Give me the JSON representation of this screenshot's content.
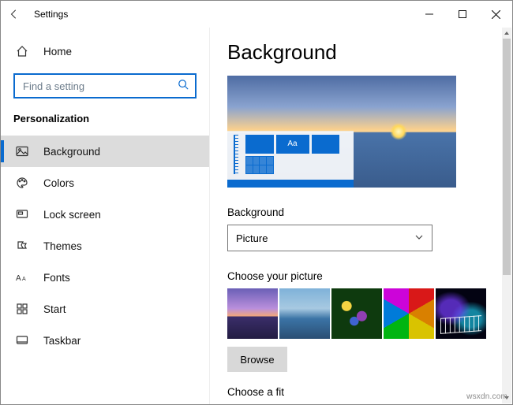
{
  "titlebar": {
    "title": "Settings"
  },
  "sidebar": {
    "home_label": "Home",
    "search_placeholder": "Find a setting",
    "category_label": "Personalization",
    "items": [
      {
        "label": "Background"
      },
      {
        "label": "Colors"
      },
      {
        "label": "Lock screen"
      },
      {
        "label": "Themes"
      },
      {
        "label": "Fonts"
      },
      {
        "label": "Start"
      },
      {
        "label": "Taskbar"
      }
    ]
  },
  "content": {
    "page_title": "Background",
    "preview_tile_text": "Aa",
    "background_label": "Background",
    "background_value": "Picture",
    "choose_picture_label": "Choose your picture",
    "browse_label": "Browse",
    "choose_fit_label": "Choose a fit"
  },
  "watermark": "wsxdn.com"
}
